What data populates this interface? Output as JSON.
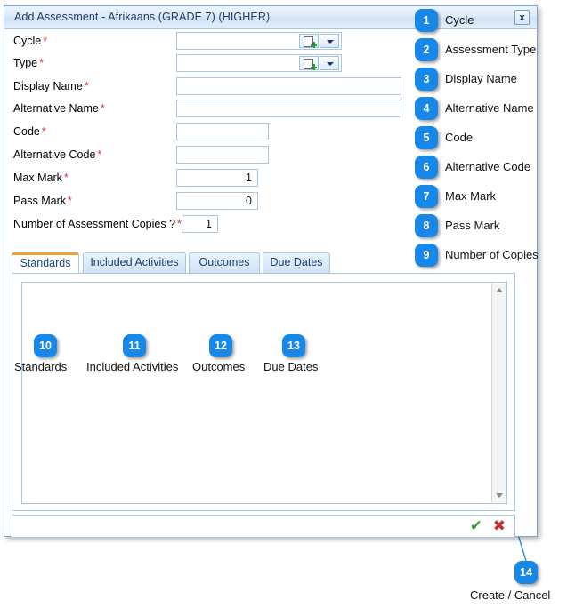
{
  "dialog": {
    "title": "Add Assessment - Afrikaans (GRADE 7) (HIGHER)",
    "close_label": "x"
  },
  "form": {
    "fields": [
      {
        "label": "Cycle",
        "required": "*",
        "value": "",
        "type": "combo"
      },
      {
        "label": "Type",
        "required": "*",
        "value": "",
        "type": "combo"
      },
      {
        "label": "Display Name",
        "required": "*",
        "value": "",
        "type": "text"
      },
      {
        "label": "Alternative Name",
        "required": "*",
        "value": "",
        "type": "text"
      },
      {
        "label": "Code",
        "required": "*",
        "value": "",
        "type": "text"
      },
      {
        "label": "Alternative Code",
        "required": "*",
        "value": "",
        "type": "text"
      },
      {
        "label": "Max Mark",
        "required": "*",
        "value": "1",
        "type": "number"
      },
      {
        "label": "Pass Mark",
        "required": "*",
        "value": "0",
        "type": "number"
      },
      {
        "label": "Number of Assessment Copies ?",
        "required": "*",
        "value": "1",
        "type": "number"
      }
    ]
  },
  "tabs": [
    {
      "label": "Standards",
      "active": true
    },
    {
      "label": "Included Activities",
      "active": false
    },
    {
      "label": "Outcomes",
      "active": false
    },
    {
      "label": "Due Dates",
      "active": false
    }
  ],
  "footer": {
    "confirm_icon": "✔",
    "cancel_icon": "✖"
  },
  "callouts": [
    {
      "number": "1",
      "text": "Cycle"
    },
    {
      "number": "2",
      "text": "Assessment Type"
    },
    {
      "number": "3",
      "text": "Display Name"
    },
    {
      "number": "4",
      "text": "Alternative Name"
    },
    {
      "number": "5",
      "text": "Code"
    },
    {
      "number": "6",
      "text": "Alternative Code"
    },
    {
      "number": "7",
      "text": "Max Mark"
    },
    {
      "number": "8",
      "text": "Pass Mark"
    },
    {
      "number": "9",
      "text": "Number of Copies"
    },
    {
      "number": "10",
      "text": "Standards"
    },
    {
      "number": "11",
      "text": "Included Activities"
    },
    {
      "number": "12",
      "text": "Outcomes"
    },
    {
      "number": "13",
      "text": "Due Dates"
    },
    {
      "number": "14",
      "text": "Create / Cancel"
    }
  ],
  "colors": {
    "badge": "#1787e8",
    "leader": "#2f8fdf",
    "active_tab_accent": "#f0a030",
    "required": "#e03131",
    "confirm": "#35a035",
    "cancel": "#c22f2f"
  }
}
